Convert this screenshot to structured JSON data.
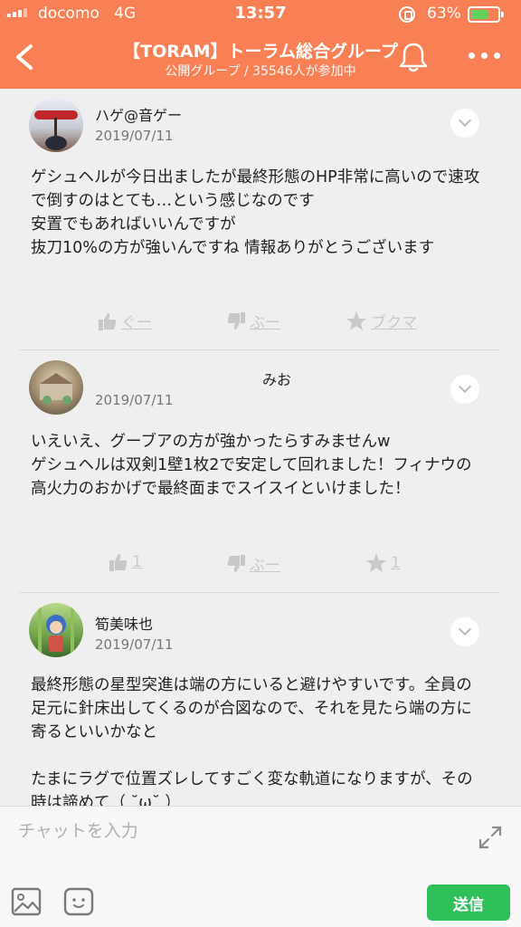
{
  "status_bar": {
    "carrier": "docomo",
    "network": "4G",
    "time": "13:57",
    "battery_percent": "63%",
    "battery_level": 0.63
  },
  "header": {
    "title": "【TORAM】トーラム総合グループ",
    "subtitle": "公開グループ / 35546人が参加中",
    "back_icon": "chevron-left-icon",
    "bell_icon": "bell-icon",
    "more_icon": "more-dots-icon"
  },
  "posts": [
    {
      "author": "ハゲ@音ゲー",
      "date": "2019/07/11",
      "body": "ゲシュヘルが今日出ましたが最終形態のHP非常に高いので速攻で倒すのはとても…という感じなのです\n安置でもあればいいんですが\n抜刀10%の方が強いんですね 情報ありがとうございます",
      "actions": {
        "like": "ぐー",
        "dislike": "ぶー",
        "bookmark": "ブクマ"
      }
    },
    {
      "author": "みお",
      "date": "2019/07/11",
      "body": "いえいえ、グーブアの方が強かったらすみませんw\nゲシュヘルは双剣1壁1枚2で安定して回れました！フィナウの高火力のおかげで最終面までスイスイといけました！",
      "actions": {
        "like": "1",
        "dislike": "ぶー",
        "bookmark": "1"
      }
    },
    {
      "author": "筍美味也",
      "date": "2019/07/11",
      "body": "最終形態の星型突進は端の方にいると避けやすいです。全員の足元に針床出してくるのが合図なので、それを見たら端の方に寄るといいかなと\n\nたまにラグで位置ズレしてすごく変な軌道になりますが、その時は諦めて（ ˘ω˘ ）"
    }
  ],
  "composer": {
    "placeholder": "チャットを入力",
    "send_label": "送信",
    "accent": "#2fc05a"
  },
  "colors": {
    "header_bg": "#f88054",
    "feed_bg": "#efefef"
  }
}
